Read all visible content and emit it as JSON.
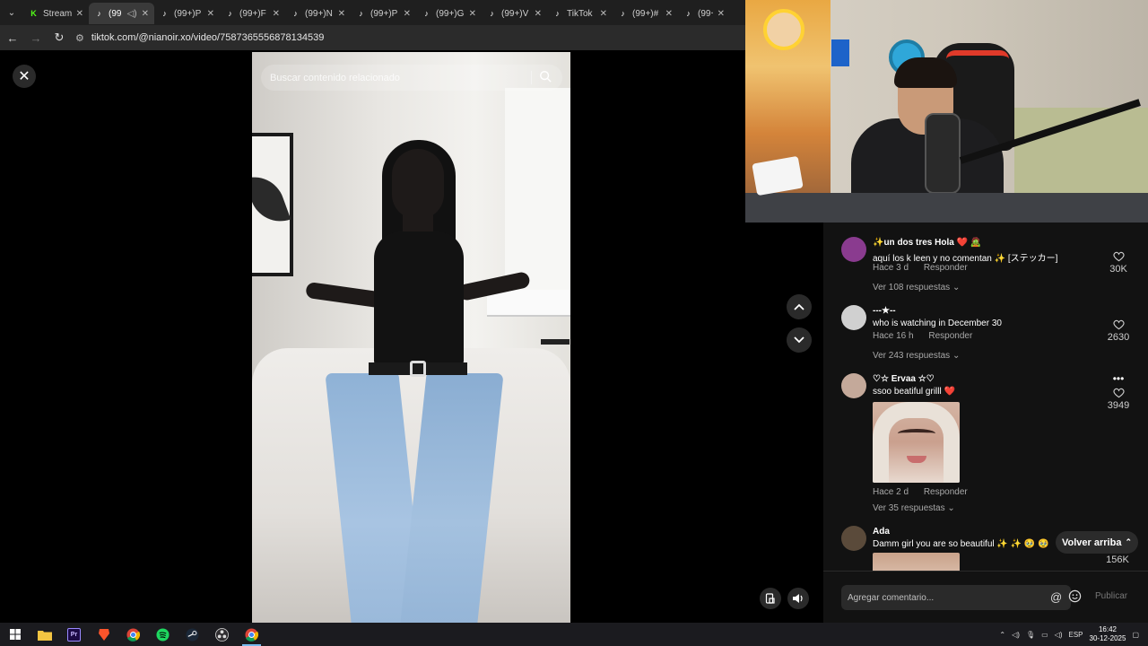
{
  "browser": {
    "tabs": [
      {
        "label": "Stream",
        "icon": "kick-icon",
        "active": false
      },
      {
        "label": "(99",
        "icon": "tiktok-icon",
        "active": true
      },
      {
        "label": "(99+)P",
        "icon": "tiktok-icon",
        "active": false
      },
      {
        "label": "(99+)F",
        "icon": "tiktok-icon",
        "active": false
      },
      {
        "label": "(99+)N",
        "icon": "tiktok-icon",
        "active": false
      },
      {
        "label": "(99+)P",
        "icon": "tiktok-icon",
        "active": false
      },
      {
        "label": "(99+)G",
        "icon": "tiktok-icon",
        "active": false
      },
      {
        "label": "(99+)V",
        "icon": "tiktok-icon",
        "active": false
      },
      {
        "label": "TikTok",
        "icon": "tiktok-icon",
        "active": false
      },
      {
        "label": "(99+)#",
        "icon": "tiktok-icon",
        "active": false
      },
      {
        "label": "(99+",
        "icon": "tiktok-icon",
        "active": false
      }
    ],
    "url": "tiktok.com/@nianoir.xo/video/7587365556878134539"
  },
  "video": {
    "search_placeholder": "Buscar contenido relacionado"
  },
  "comments": [
    {
      "user": "✨un dos tres Hola ❤️ 🧟",
      "text": "aquí los k leen y no comentan ✨ [ステッカー]",
      "time": "Hace 3 d",
      "reply_label": "Responder",
      "replies_label": "Ver 108 respuestas",
      "likes": "30K",
      "avatar_color": "#8a3b8f"
    },
    {
      "user": "---★--",
      "text": "who is watching in December 30",
      "time": "Hace 16 h",
      "reply_label": "Responder",
      "replies_label": "Ver 243 respuestas",
      "likes": "2630",
      "avatar_color": "#d0d0d0"
    },
    {
      "user": "♡☆ Ervaa ☆♡",
      "text": "ssoo beatiful grilll ❤️",
      "time": "Hace 2 d",
      "reply_label": "Responder",
      "replies_label": "Ver 35 respuestas",
      "likes": "3949",
      "avatar_color": "#c4a99a"
    },
    {
      "user": "Ada",
      "text": "Damm girl you are so beautiful ✨ ✨ 🥹 🥹",
      "likes": "156K",
      "avatar_color": "#5a4a3a"
    }
  ],
  "back_to_top_label": "Volver arriba",
  "composer": {
    "placeholder": "Agregar comentario...",
    "publish_label": "Publicar"
  },
  "taskbar": {
    "language": "ESP",
    "time": "16:42",
    "date": "30-12-2025"
  },
  "colors": {
    "background": "#000000",
    "panel": "#121212",
    "accent_heart": "#fe2c55"
  }
}
